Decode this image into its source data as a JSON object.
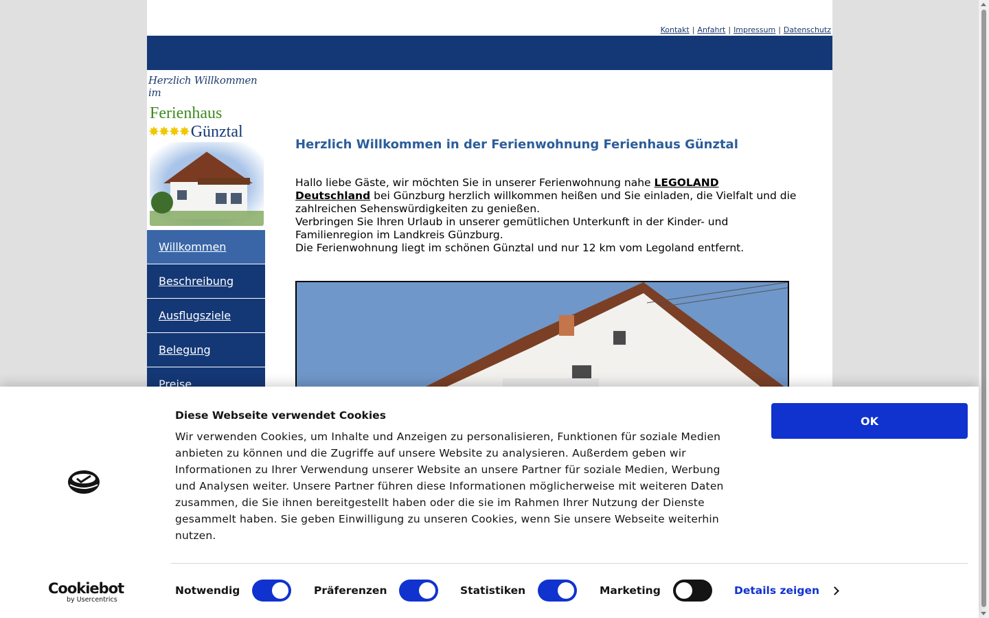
{
  "top_links": [
    "Kontakt",
    "Anfahrt",
    "Impressum",
    "Datenschutz"
  ],
  "logo": {
    "script": "Herzlich Willkommen im",
    "name1": "Ferienhaus",
    "stars": "✸✸✸✸",
    "name2": "Günztal"
  },
  "nav": [
    {
      "label": "Willkommen",
      "active": true
    },
    {
      "label": "Beschreibung",
      "active": false
    },
    {
      "label": "Ausflugsziele",
      "active": false
    },
    {
      "label": "Belegung",
      "active": false
    },
    {
      "label": "Preise",
      "active": false
    }
  ],
  "main": {
    "heading": "Herzlich Willkommen in der Ferienwohnung Ferienhaus Günztal",
    "p1_before": "Hallo liebe Gäste, wir möchten Sie in unserer Ferienwohnung nahe ",
    "p1_link": "LEGOLAND Deutschland",
    "p1_after": " bei Günzburg herzlich willkommen heißen und Sie einladen, die Vielfalt und die zahlreichen Sehenswürdigkeiten zu genießen.",
    "p2": "Verbringen Sie Ihren Urlaub in unserer gemütlichen Unterkunft in der Kinder- und Familienregion im Landkreis Günzburg.",
    "p3": "Die Ferienwohnung liegt im schönen Günztal und nur 12 km vom Legoland entfernt."
  },
  "cookie": {
    "title": "Diese Webseite verwendet Cookies",
    "text": "Wir verwenden Cookies, um Inhalte und Anzeigen zu personalisieren, Funktionen für soziale Medien anbieten zu können und die Zugriffe auf unsere Website zu analysieren. Außerdem geben wir Informationen zu Ihrer Verwendung unserer Website an unsere Partner für soziale Medien, Werbung und Analysen weiter. Unsere Partner führen diese Informationen möglicherweise mit weiteren Daten zusammen, die Sie ihnen bereitgestellt haben oder die sie im Rahmen Ihrer Nutzung der Dienste gesammelt haben. Sie geben Einwilligung zu unseren Cookies, wenn Sie unsere Webseite weiterhin nutzen.",
    "ok_label": "OK",
    "brand": "Cookiebot",
    "brand_sub": "by Usercentrics",
    "toggles": [
      {
        "label": "Notwendig",
        "on": true
      },
      {
        "label": "Präferenzen",
        "on": true
      },
      {
        "label": "Statistiken",
        "on": true
      },
      {
        "label": "Marketing",
        "on": false
      }
    ],
    "details_label": "Details zeigen"
  },
  "colors": {
    "nav_blue": "#143876",
    "nav_active": "#3a66a8",
    "heading": "#2c5d99",
    "cookie_accent": "#1032cf"
  }
}
